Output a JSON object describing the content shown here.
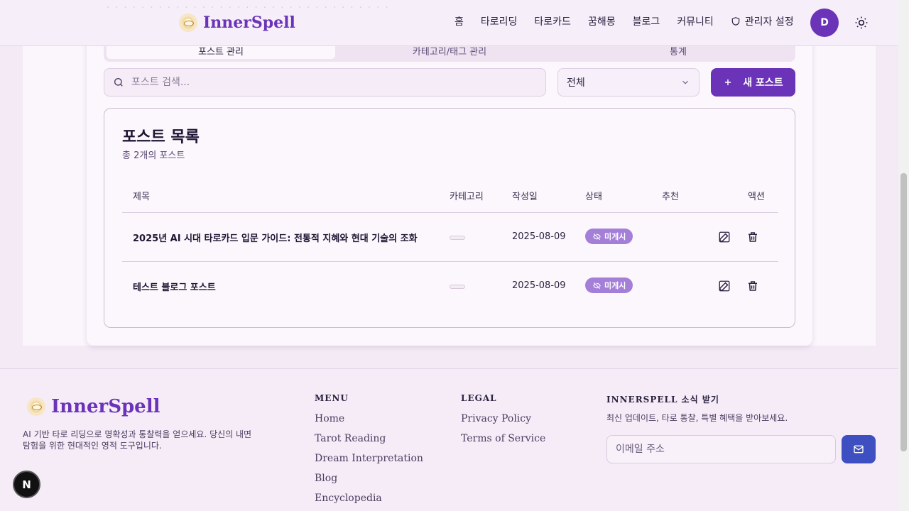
{
  "header": {
    "logo_text": "InnerSpell",
    "nav": [
      "홈",
      "타로리딩",
      "타로카드",
      "꿈해몽",
      "블로그",
      "커뮤니티"
    ],
    "admin_label": "관리자 설정",
    "avatar_initial": "D"
  },
  "tabs": [
    "포스트 관리",
    "카테고리/태그 관리",
    "통계"
  ],
  "toolbar": {
    "search_placeholder": "포스트 검색...",
    "filter_value": "전체",
    "new_post_label": "새 포스트"
  },
  "list": {
    "title": "포스트 목록",
    "subtitle": "총 2개의 포스트",
    "columns": [
      "제목",
      "카테고리",
      "작성일",
      "상태",
      "추천",
      "액션"
    ],
    "rows": [
      {
        "title": "2025년 AI 시대 타로카드 입문 가이드: 전통적 지혜와 현대 기술의 조화",
        "date": "2025-08-09",
        "status": "미게시"
      },
      {
        "title": "테스트 블로그 포스트",
        "date": "2025-08-09",
        "status": "미게시"
      }
    ]
  },
  "footer": {
    "logo_text": "InnerSpell",
    "description": "AI 기반 타로 리딩으로 명확성과 통찰력을 얻으세요. 당신의 내면 탐험을 위한 현대적인 영적 도구입니다.",
    "menu_title": "MENU",
    "menu_links": [
      "Home",
      "Tarot Reading",
      "Dream Interpretation",
      "Blog",
      "Encyclopedia"
    ],
    "legal_title": "LEGAL",
    "legal_links": [
      "Privacy Policy",
      "Terms of Service"
    ],
    "newsletter_title": "INNERSPELL 소식 받기",
    "newsletter_subtitle": "최신 업데이트, 타로 통찰, 특별 혜택을 받아보세요.",
    "email_placeholder": "이메일 주소"
  },
  "dev_badge": "N",
  "colors": {
    "brand": "#6a33b8",
    "badge": "#a47fd8",
    "send_button": "#3e4fc1"
  }
}
